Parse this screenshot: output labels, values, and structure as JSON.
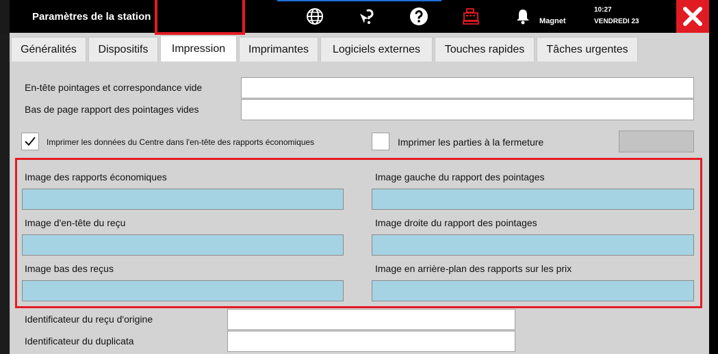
{
  "header": {
    "title": "Paramètres de la station",
    "icons": [
      "globe-icon",
      "pointer-question-icon",
      "help-icon",
      "cash-register-icon",
      "bell-icon"
    ],
    "magnet_label": "Magnet",
    "time": "10:27",
    "date": "VENDREDI 23"
  },
  "tabs": [
    {
      "label": "Généralités",
      "active": false
    },
    {
      "label": "Dispositifs",
      "active": false
    },
    {
      "label": "Impression",
      "active": true
    },
    {
      "label": "Imprimantes",
      "active": false
    },
    {
      "label": "Logiciels externes",
      "active": false
    },
    {
      "label": "Touches rapides",
      "active": false
    },
    {
      "label": "Tâches urgentes",
      "active": false
    }
  ],
  "form": {
    "header_empty_label": "En-tête pointages et correspondance vide",
    "header_empty_value": "",
    "footer_empty_label": "Bas de page rapport des pointages vides",
    "footer_empty_value": "",
    "print_center_label": "Imprimer les données du Centre dans l'en-tête des rapports économiques",
    "print_center_checked": true,
    "print_games_label": "Imprimer les parties à la fermeture",
    "print_games_checked": false,
    "images": {
      "economic_reports": "Image des rapports économiques",
      "left_attendance": "Image gauche du rapport des pointages",
      "receipt_header": "Image d'en-tête du reçu",
      "right_attendance": "Image droite du rapport des pointages",
      "receipt_bottom": "Image bas des reçus",
      "price_background": "Image en arrière-plan des rapports sur les prix"
    },
    "original_receipt_label": "Identificateur du reçu d'origine",
    "original_receipt_value": "",
    "duplicate_label": "Identificateur du duplicata",
    "duplicate_value": ""
  },
  "colors": {
    "accent_red": "#e31b23",
    "image_field": "#a6d3e3",
    "panel_bg": "#d3d3d3"
  }
}
